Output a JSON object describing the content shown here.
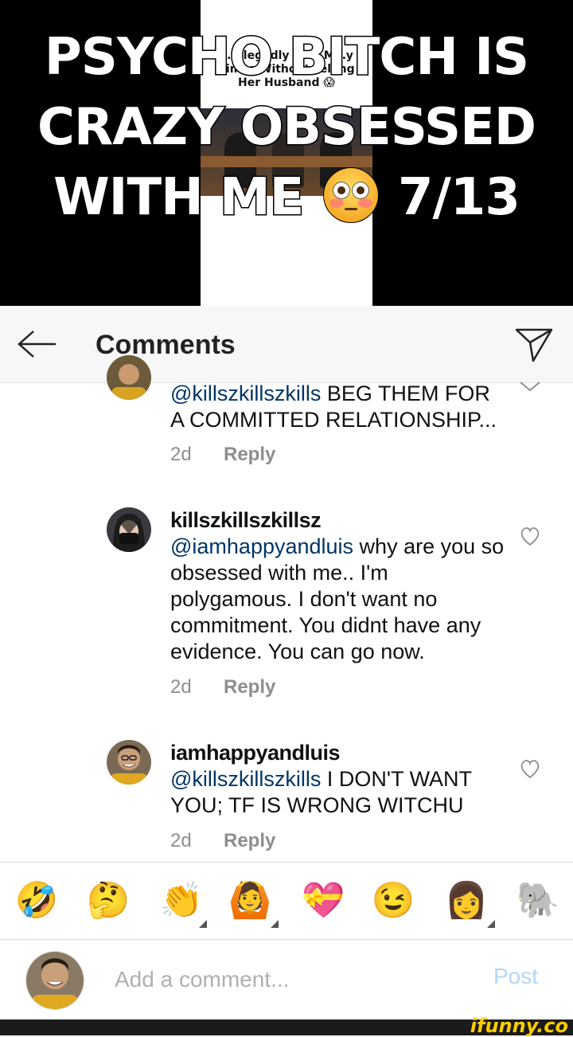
{
  "meme": {
    "caption_line1": "PSYCHO BITCH IS",
    "caption_line2": "CRAZY OBSESSED",
    "caption_line3a": "WITH ME",
    "caption_line3b": "7/13",
    "thumbnail_title": "…Allegedly …ed M…y Times Without Telling Her Husband 😱"
  },
  "header": {
    "title": "Comments",
    "back_icon": "arrow-left-icon",
    "direct_icon": "paper-plane-icon"
  },
  "comments": [
    {
      "username": "",
      "mention": "@killszkillszkills",
      "text": " BEG THEM FOR A COMMITTED RELATIONSHIP...",
      "age": "2d",
      "reply_label": "Reply"
    },
    {
      "username": "killszkillszkillsz",
      "mention": "@iamhappyandluis",
      "text": " why are you so obsessed with me.. I'm polygamous.  I don't want no commitment. You didnt have any evidence. You can go now.",
      "age": "2d",
      "reply_label": "Reply"
    },
    {
      "username": "iamhappyandluis",
      "mention": "@killszkillszkills",
      "text": " I DON'T WANT YOU; TF IS WRONG WITCHU",
      "age": "2d",
      "reply_label": "Reply"
    }
  ],
  "emoji_bar": [
    "🤣",
    "🤔",
    "👏",
    "🙆",
    "💝",
    "😉",
    "👩",
    "🐘"
  ],
  "composer": {
    "placeholder": "Add a comment...",
    "post_label": "Post"
  },
  "watermark": "ifunny.co",
  "colors": {
    "mention": "#003569",
    "meta": "#8e8e8e",
    "post_disabled": "#b3d7fb",
    "watermark": "#ffcc00"
  }
}
